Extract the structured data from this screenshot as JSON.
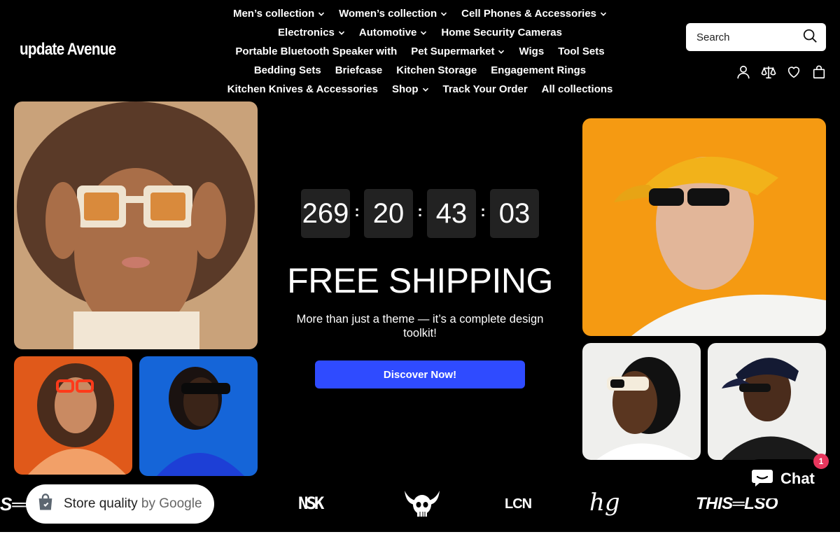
{
  "brand": {
    "logo_text": "update Avenue"
  },
  "nav": {
    "rows": [
      [
        {
          "label": "Men’s collection",
          "dropdown": true
        },
        {
          "label": "Women’s collection",
          "dropdown": true
        },
        {
          "label": "Cell Phones & Accessories",
          "dropdown": true
        }
      ],
      [
        {
          "label": "Electronics",
          "dropdown": true
        },
        {
          "label": "Automotive",
          "dropdown": true
        },
        {
          "label": "Home Security Cameras",
          "dropdown": false
        }
      ],
      [
        {
          "label": "Portable Bluetooth Speaker with",
          "dropdown": false
        },
        {
          "label": "Pet Supermarket",
          "dropdown": true
        },
        {
          "label": "Wigs",
          "dropdown": false
        },
        {
          "label": "Tool Sets",
          "dropdown": false
        }
      ],
      [
        {
          "label": "Bedding Sets",
          "dropdown": false
        },
        {
          "label": "Briefcase",
          "dropdown": false
        },
        {
          "label": "Kitchen Storage",
          "dropdown": false
        },
        {
          "label": "Engagement Rings",
          "dropdown": false
        }
      ],
      [
        {
          "label": "Kitchen Knives & Accessories",
          "dropdown": false
        },
        {
          "label": "Shop",
          "dropdown": true
        },
        {
          "label": "Track Your Order",
          "dropdown": false
        },
        {
          "label": "All collections",
          "dropdown": false
        }
      ]
    ]
  },
  "search": {
    "placeholder": "Search",
    "icon": "search-icon"
  },
  "header_icons": [
    "account-icon",
    "compare-icon",
    "wishlist-heart-icon",
    "cart-bag-icon"
  ],
  "hero": {
    "countdown": {
      "days": "269",
      "hours": "20",
      "minutes": "43",
      "seconds": "03",
      "separator": ":"
    },
    "title": "FREE SHIPPING",
    "subtitle": "More than just a theme — it’s a complete design toolkit!",
    "cta_label": "Discover Now!"
  },
  "brands": {
    "logos": [
      "S══",
      "NSK",
      "skull-horns-logo",
      "LCN",
      "hg",
      "THIS═LSO"
    ]
  },
  "store_badge": {
    "prefix": "Store quality",
    "suffix": "by Google"
  },
  "chat": {
    "label": "Chat",
    "badge_count": "1"
  },
  "colors": {
    "background": "#000000",
    "accent_button": "#2f4bff",
    "countdown_box": "#222222",
    "badge": "#e8365d"
  }
}
